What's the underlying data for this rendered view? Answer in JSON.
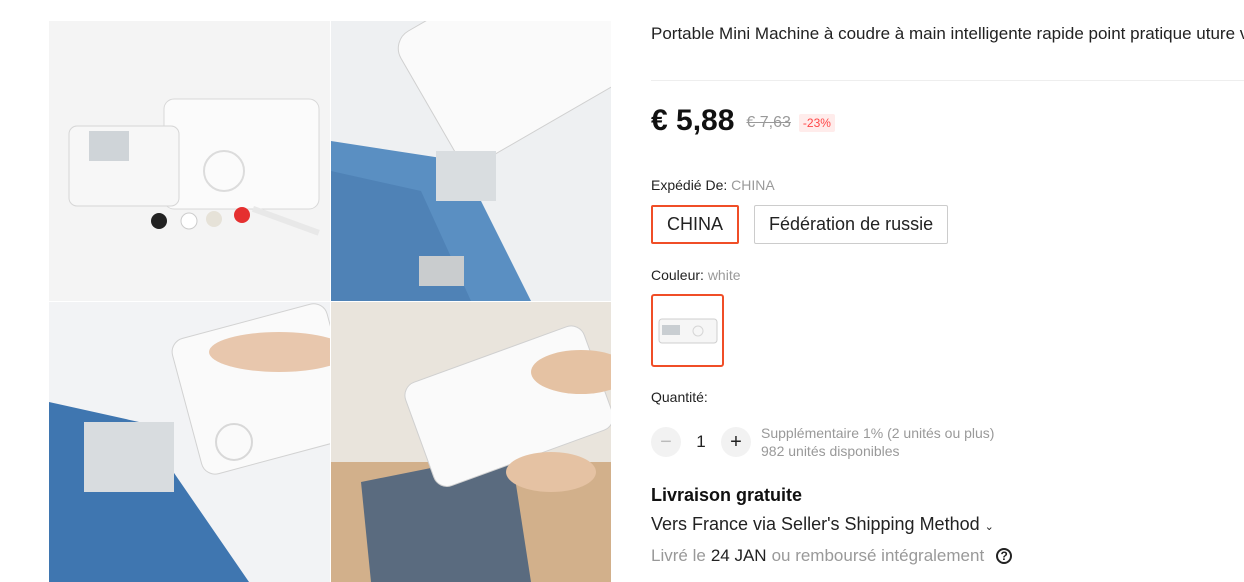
{
  "product": {
    "title": "Portable Mini Machine à coudre à main intelligente rapide point pratique uture vêtements sans fil ménage Machine à coudre électrique",
    "price": "€ 5,88",
    "old_price": "€ 7,63",
    "discount": "-23%"
  },
  "shipping_from": {
    "label": "Expédié De:",
    "selected": "CHINA",
    "options": [
      "CHINA",
      "Fédération de russie"
    ]
  },
  "color": {
    "label": "Couleur:",
    "selected": "white"
  },
  "quantity": {
    "label": "Quantité:",
    "value": "1",
    "minus": "−",
    "plus": "+",
    "note_line1": "Supplémentaire 1% (2 unités ou plus)",
    "note_line2": "982 unités disponibles"
  },
  "delivery": {
    "title": "Livraison gratuite",
    "method": "Vers France via Seller's Shipping Method",
    "chevron": "⌄",
    "prefix": "Livré le",
    "date": "24 JAN",
    "suffix": "ou remboursé intégralement",
    "help": "?"
  },
  "icons": {
    "help": "help-circle-icon",
    "chevron": "chevron-down-icon"
  },
  "colors": {
    "accent": "#f04e27",
    "discount_text": "#ff4747",
    "discount_bg": "#ffeceb",
    "muted": "#999999"
  }
}
